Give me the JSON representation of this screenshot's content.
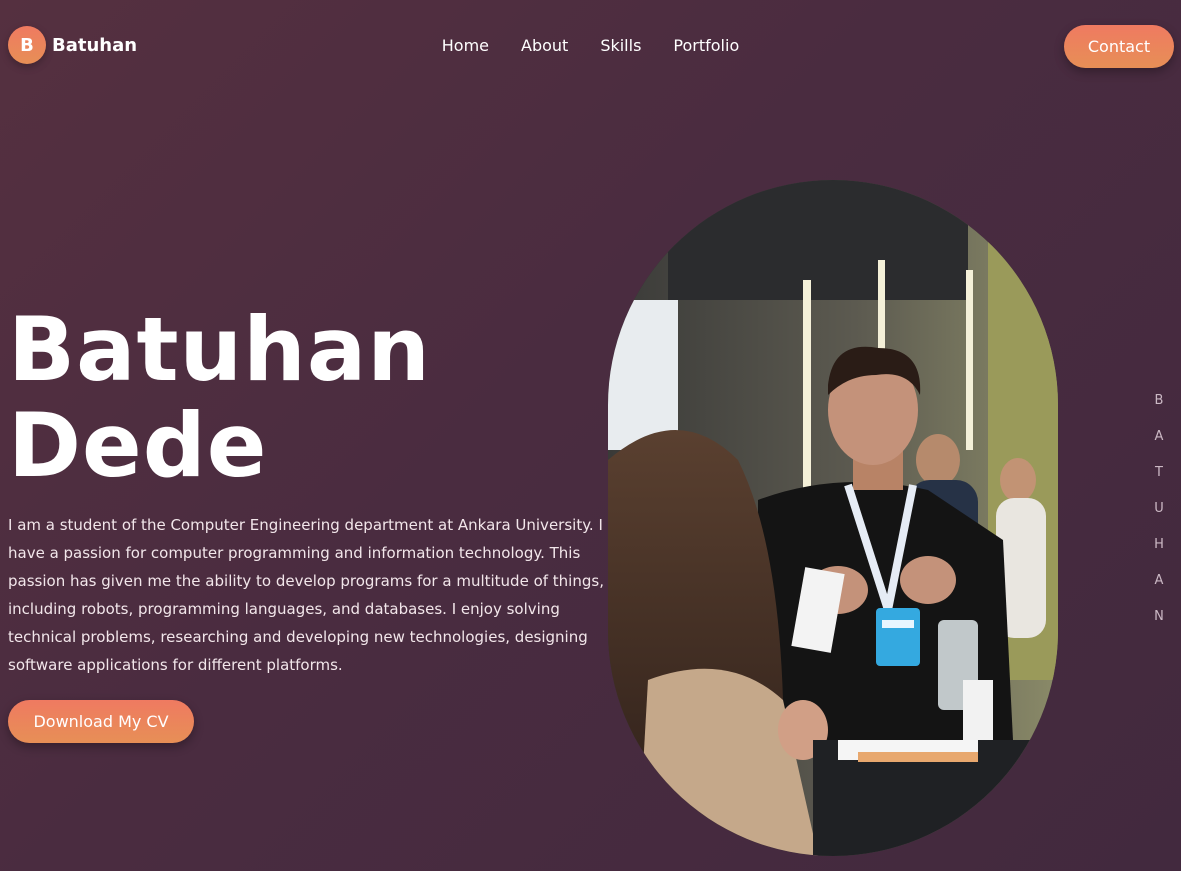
{
  "brand": {
    "initial": "B",
    "name": "Batuhan"
  },
  "nav": {
    "items": [
      "Home",
      "About",
      "Skills",
      "Portfolio"
    ],
    "contact_label": "Contact"
  },
  "hero": {
    "first_name": "Batuhan",
    "last_name": "Dede",
    "description": "I am a student of the Computer Engineering department at Ankara University. I have a passion for computer programming and information technology. This passion has given me the ability to develop programs for a multitude of things, including robots, programming languages, and databases. I enjoy solving technical problems, researching and developing new technologies, designing software applications for different platforms.",
    "cv_button": "Download My CV"
  },
  "side": {
    "letters": [
      "B",
      "A",
      "T",
      "U",
      "H",
      "A",
      "N"
    ]
  },
  "colors": {
    "accent_start": "#ef7a61",
    "accent_end": "#e78f56",
    "background": "#4a2c40"
  }
}
